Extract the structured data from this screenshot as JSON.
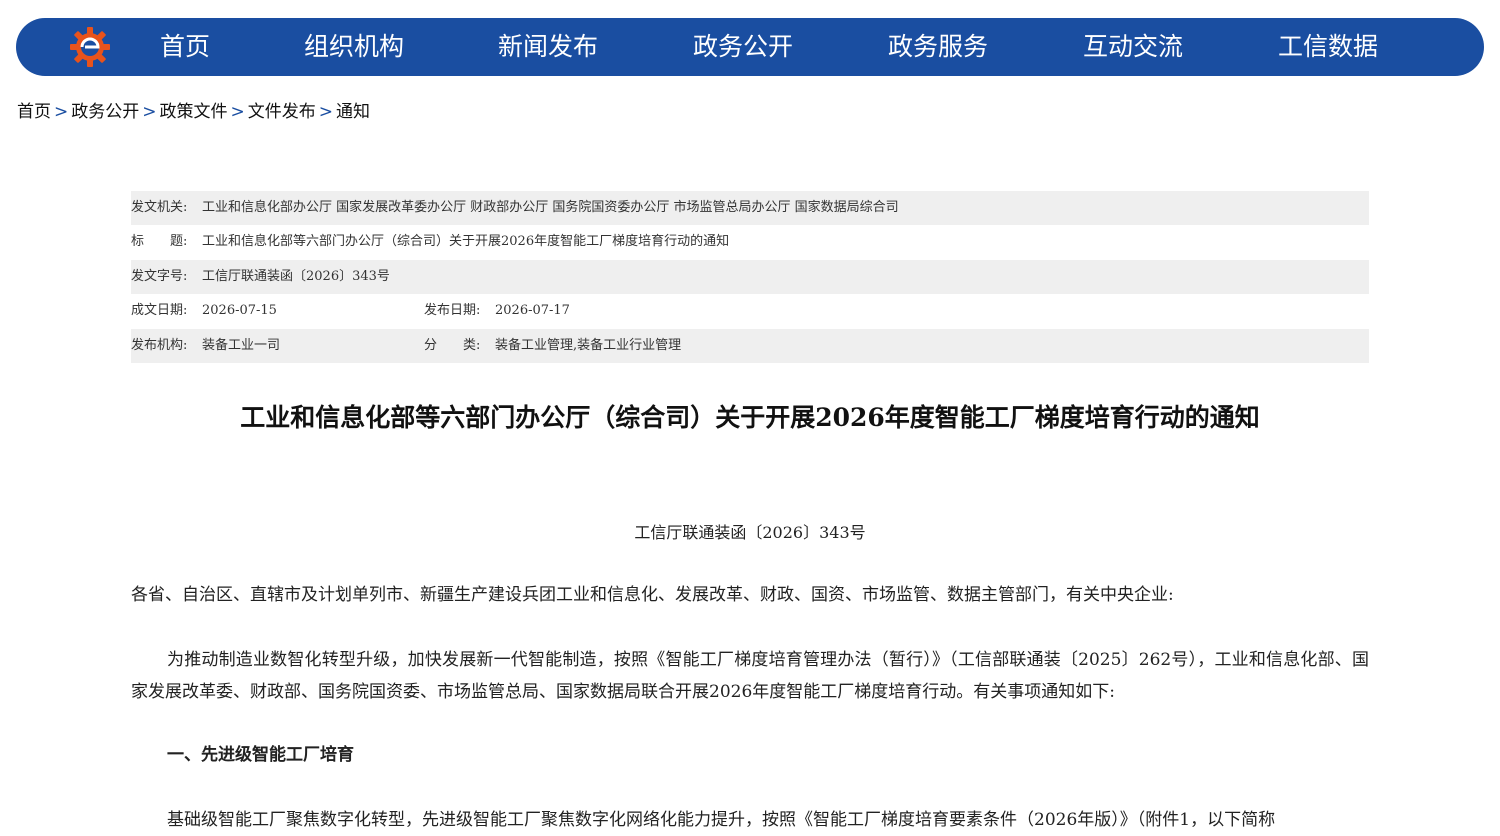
{
  "nav": {
    "items": [
      "首页",
      "组织机构",
      "新闻发布",
      "政务公开",
      "政务服务",
      "互动交流",
      "工信数据"
    ],
    "accent_color": "#1a4ea1"
  },
  "breadcrumb": {
    "items": [
      "首页",
      "政务公开",
      "政策文件",
      "文件发布",
      "通知"
    ],
    "separator": ">"
  },
  "meta": {
    "issuer_label": "发文机关:",
    "issuer": "工业和信息化部办公厅 国家发展改革委办公厅 财政部办公厅 国务院国资委办公厅 市场监管总局办公厅 国家数据局综合司",
    "title_label": "标　　题:",
    "title": "工业和信息化部等六部门办公厅（综合司）关于开展2026年度智能工厂梯度培育行动的通知",
    "doc_no_label": "发文字号:",
    "doc_no": "工信厅联通装函〔2026〕343号",
    "written_date_label": "成文日期:",
    "written_date": "2026-07-15",
    "publish_date_label": "发布日期:",
    "publish_date": "2026-07-17",
    "publisher_label": "发布机构:",
    "publisher": "装备工业一司",
    "category_label": "分　　类:",
    "category": "装备工业管理,装备工业行业管理"
  },
  "document": {
    "title": "工业和信息化部等六部门办公厅（综合司）关于开展2026年度智能工厂梯度培育行动的通知",
    "number": "工信厅联通装函〔2026〕343号",
    "salutation": "各省、自治区、直辖市及计划单列市、新疆生产建设兵团工业和信息化、发展改革、财政、国资、市场监管、数据主管部门，有关中央企业:",
    "body1": "为推动制造业数智化转型升级，加快发展新一代智能制造，按照《智能工厂梯度培育管理办法（暂行）》（工信部联通装〔2025〕262号），工业和信息化部、国家发展改革委、财政部、国务院国资委、市场监管总局、国家数据局联合开展2026年度智能工厂梯度培育行动。有关事项通知如下:",
    "section1": "一、先进级智能工厂培育",
    "body2": "基础级智能工厂聚焦数字化转型，先进级智能工厂聚焦数字化网络化能力提升，按照《智能工厂梯度培育要素条件（2026年版）》（附件1，以下简称"
  }
}
